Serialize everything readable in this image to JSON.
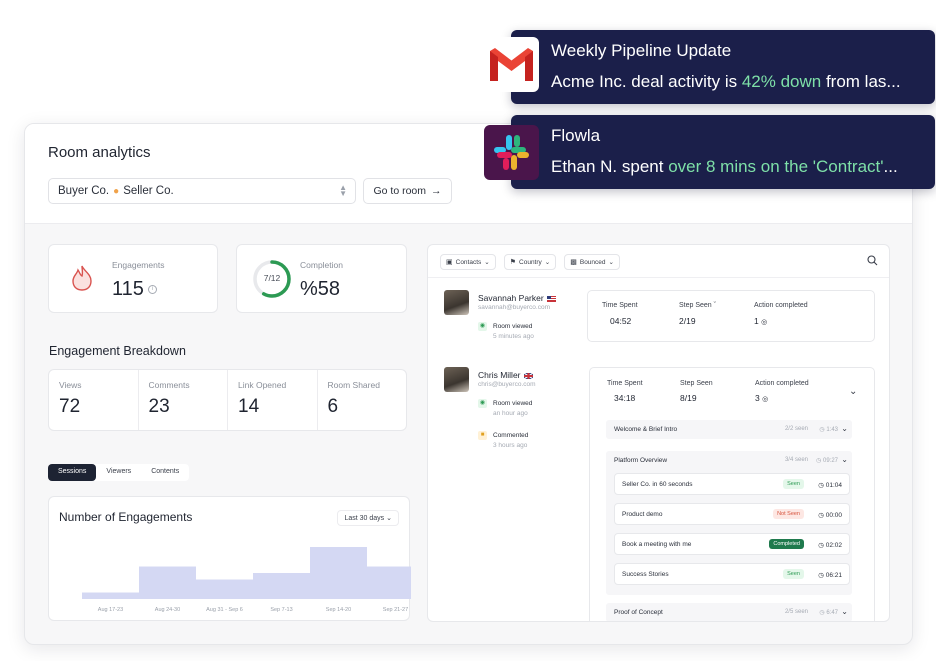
{
  "window": {
    "title": "Room analytics",
    "room_select": {
      "left": "Buyer Co.",
      "right": "Seller Co."
    },
    "goto_button": "Go to room"
  },
  "engagements": {
    "label": "Engagements",
    "value": "115"
  },
  "completion": {
    "label": "Completion",
    "value": "%58",
    "ring_text": "7/12",
    "ring_progress": 0.58
  },
  "breakdown": {
    "title": "Engagement Breakdown",
    "cells": [
      {
        "label": "Views",
        "value": "72"
      },
      {
        "label": "Comments",
        "value": "23"
      },
      {
        "label": "Link Opened",
        "value": "14"
      },
      {
        "label": "Room Shared",
        "value": "6"
      }
    ]
  },
  "tabs": [
    "Sessions",
    "Viewers",
    "Contents"
  ],
  "engagement_chart": {
    "title": "Number of Engagements",
    "range": "Last 30 days"
  },
  "chart_data": {
    "type": "bar",
    "title": "Number of Engagements",
    "categories": [
      "Aug 17-23",
      "Aug 24-30",
      "Aug 31 - Sep 6",
      "Sep 7-13",
      "Sep 14-20",
      "Sep 21-27"
    ],
    "values": [
      1,
      5,
      3,
      4,
      8,
      5
    ],
    "ylim": [
      0,
      8
    ]
  },
  "filters": [
    "Contacts",
    "Country",
    "Bounced"
  ],
  "contacts": [
    {
      "name": "Savannah Parker",
      "email": "savannah@buyerco.com",
      "activities": [
        {
          "text": "Room viewed",
          "when": "5 minutes ago"
        }
      ],
      "metrics": {
        "time_label": "Time Spent",
        "time": "04:52",
        "step_label": "Step Seen",
        "step": "2/19",
        "action_label": "Action completed",
        "action": "1"
      }
    },
    {
      "name": "Chris Miller",
      "email": "chris@buyerco.com",
      "activities": [
        {
          "text": "Room viewed",
          "when": "an hour ago"
        },
        {
          "text": "Commented",
          "when": "3 hours ago"
        }
      ],
      "metrics": {
        "time_label": "Time Spent",
        "time": "34:18",
        "step_label": "Step Seen",
        "step": "8/19",
        "action_label": "Action completed",
        "action": "3"
      }
    }
  ],
  "stages": [
    {
      "name": "Welcome & Brief Intro",
      "count": "2/2 seen",
      "time": "1:43"
    },
    {
      "name": "Platform Overview",
      "count": "3/4 seen",
      "time": "09:27"
    },
    {
      "name": "Proof of Concept",
      "count": "2/5 seen",
      "time": "6:47"
    }
  ],
  "items": [
    {
      "name": "Seller Co. in 60 seconds",
      "status": "Seen",
      "time": "01:04"
    },
    {
      "name": "Product demo",
      "status": "Not Seen",
      "time": "00:00"
    },
    {
      "name": "Book a meeting with me",
      "status": "Completed",
      "time": "02:02"
    },
    {
      "name": "Success Stories",
      "status": "Seen",
      "time": "06:21"
    }
  ],
  "notifications": [
    {
      "app": "gmail-icon",
      "title": "Weekly Pipeline Update",
      "body_pre": "Acme Inc. deal activity is ",
      "body_hl": "42% down",
      "body_post": " from las..."
    },
    {
      "app": "slack-icon",
      "title": "Flowla",
      "body_pre": "Ethan N. spent ",
      "body_hl": "over 8 mins on the 'Contract'",
      "body_post": "..."
    }
  ],
  "colors": {
    "bar_fill": "#d4d8f3",
    "notif_bg": "#1b1f4a",
    "highlight": "#7ee0a8",
    "ring": "#2c9a53"
  }
}
